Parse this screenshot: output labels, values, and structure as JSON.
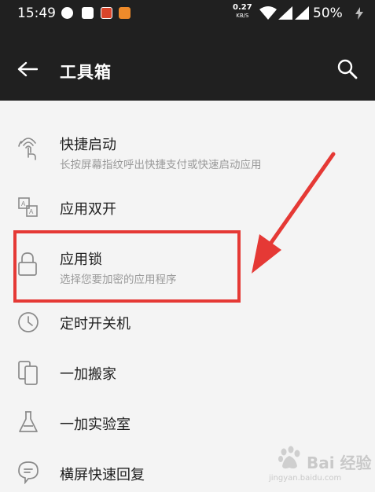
{
  "status_bar": {
    "time": "15:49",
    "net_speed": "0.27",
    "net_unit": "KB/S",
    "battery": "50%"
  },
  "app_bar": {
    "title": "工具箱",
    "back_icon": "arrow-left-icon",
    "search_icon": "search-icon"
  },
  "items": [
    {
      "label": "快捷启动",
      "sub": "长按屏幕指纹呼出快捷支付或快速启动应用",
      "icon": "fingerprint-icon"
    },
    {
      "label": "应用双开",
      "icon": "app-clone-icon"
    },
    {
      "label": "应用锁",
      "sub": "选择您要加密的应用程序",
      "icon": "lock-icon"
    },
    {
      "label": "定时开关机",
      "icon": "clock-icon"
    },
    {
      "label": "一加搬家",
      "icon": "phone-transfer-icon"
    },
    {
      "label": "一加实验室",
      "icon": "flask-icon"
    },
    {
      "label": "横屏快速回复",
      "icon": "chat-bubble-icon"
    }
  ],
  "annotation": {
    "color": "#e53935"
  },
  "watermark": {
    "text": "Bai 经验",
    "url": "jingyan.baidu.com"
  },
  "colors": {
    "app_bar": "#202020",
    "background": "#f4f4f4",
    "text_primary": "#1e1e1e",
    "text_secondary": "#9a9a9a"
  }
}
